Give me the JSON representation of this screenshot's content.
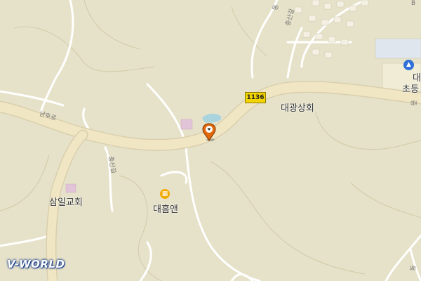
{
  "map": {
    "route_number": "1136",
    "place_labels": {
      "daegwang_store": "대광상회",
      "samil_church": "삼일교회",
      "daeheum_ann": "대흠앤",
      "school_top": "대",
      "school_bottom": "초등"
    },
    "road_labels": {
      "namho_ro": "남호로",
      "chungsan_road_left": "충산길",
      "chungsan_road_top": "충산길",
      "top_right_fragment": "동",
      "right_edge_fragment": "충",
      "bottom_right_fragment": "동",
      "top_right_edge_fragment": "B"
    },
    "icons": {
      "location_marker": "map-pin-icon",
      "poi": "building-icon",
      "school": "school-icon"
    },
    "colors": {
      "background": "#e6e2c9",
      "main_road": "#f0e6c3",
      "minor_road": "#ffffff",
      "marker": "#e3680c",
      "route_shield": "#f2d400",
      "water": "#a9d4de"
    },
    "logo": "V-WORLD"
  }
}
